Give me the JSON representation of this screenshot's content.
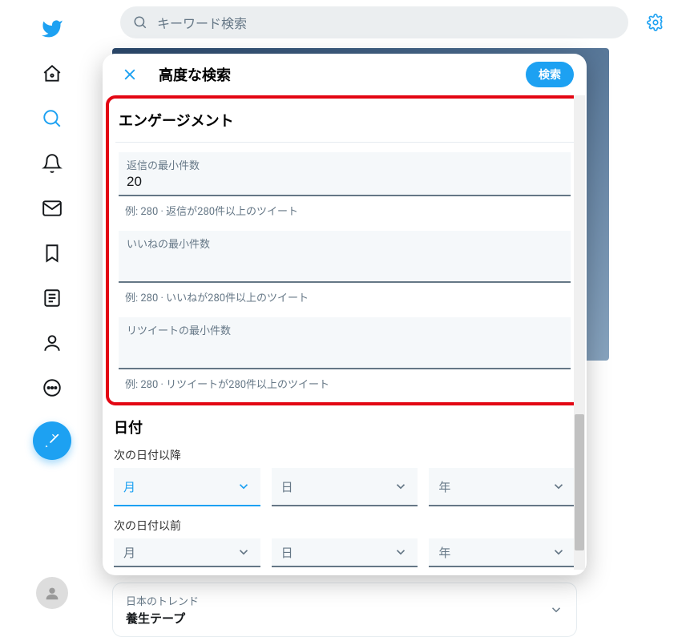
{
  "searchbar": {
    "placeholder": "キーワード検索"
  },
  "modal": {
    "title": "高度な検索",
    "search_button": "検索",
    "engagement_title": "エンゲージメント",
    "min_replies_label": "返信の最小件数",
    "min_replies_value": "20",
    "min_replies_hint": "例: 280 · 返信が280件以上のツイート",
    "min_likes_label": "いいねの最小件数",
    "min_likes_value": "",
    "min_likes_hint": "例: 280 · いいねが280件以上のツイート",
    "min_retweets_label": "リツイートの最小件数",
    "min_retweets_value": "",
    "min_retweets_hint": "例: 280 · リツイートが280件以上のツイート",
    "date_title": "日付",
    "date_after_label": "次の日付以降",
    "date_before_label": "次の日付以前",
    "month_label": "月",
    "day_label": "日",
    "year_label": "年"
  },
  "trends": {
    "sub": "日本のトレンド",
    "main": "養生テープ"
  }
}
